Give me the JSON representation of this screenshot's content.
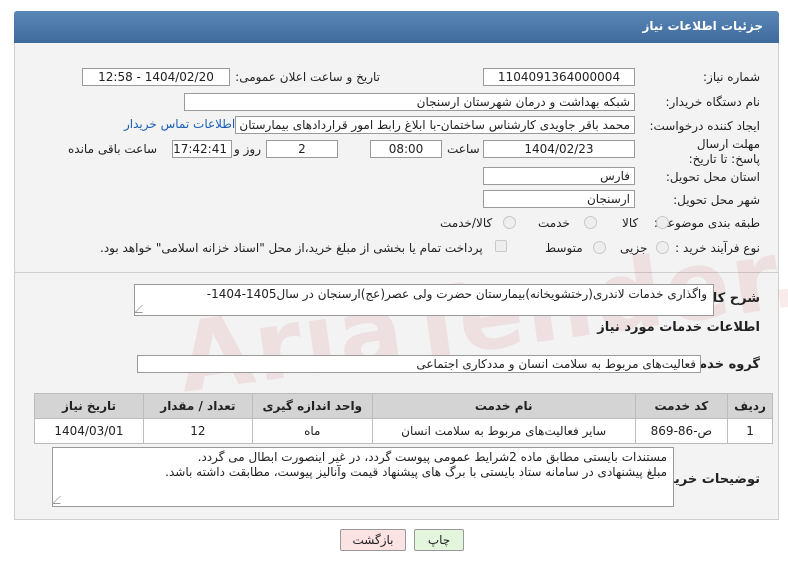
{
  "header": {
    "title": "جزئیات اطلاعات نیاز"
  },
  "fields": {
    "need_number_label": "شماره نیاز:",
    "need_number": "1104091364000004",
    "announce_label": "تاریخ و ساعت اعلان عمومی:",
    "announce_value": "1404/02/20 - 12:58",
    "buyer_org_label": "نام دستگاه خریدار:",
    "buyer_org": "شبکه بهداشت و درمان شهرستان ارسنجان",
    "creator_label": "ایجاد کننده درخواست:",
    "creator": "محمد باقر جاویدی کارشناس ساختمان-با ابلاغ رابط امور قراردادهای بیمارستان ش",
    "contact_link": "اطلاعات تماس خریدار",
    "deadline_label": "مهلت ارسال پاسخ: تا تاریخ:",
    "deadline_date": "1404/02/23",
    "time_label": "ساعت",
    "deadline_time": "08:00",
    "days_value": "2",
    "days_label": "روز و",
    "remaining_time": "17:42:41",
    "remaining_label": "ساعت باقی مانده",
    "province_label": "استان محل تحویل:",
    "province": "فارس",
    "city_label": "شهر محل تحویل:",
    "city": "ارسنجان",
    "category_label": "طبقه بندی موضوعی:",
    "cat_goods": "کالا",
    "cat_service": "خدمت",
    "cat_goods_service": "کالا/خدمت",
    "process_label": "نوع فرآیند خرید :",
    "proc_minor": "جزیی",
    "proc_medium": "متوسط",
    "payment_note": "پرداخت تمام یا بخشی از مبلغ خرید،از محل \"اسناد خزانه اسلامی\" خواهد بود."
  },
  "description": {
    "label": "شرح کلی نیاز:",
    "text": "واگذاری خدمات لاندری(رختشویخانه)بیمارستان حضرت ولی عصر(عج)ارسنجان در سال1405-1404-"
  },
  "services": {
    "section_title": "اطلاعات خدمات مورد نیاز",
    "group_label": "گروه خدمت:",
    "group_value": "فعالیت‌های مربوط به سلامت انسان و مددکاری اجتماعی",
    "columns": [
      "ردیف",
      "کد خدمت",
      "نام خدمت",
      "واحد اندازه گیری",
      "تعداد / مقدار",
      "تاریخ نیاز"
    ],
    "rows": [
      [
        "1",
        "ص-86-869",
        "سایر فعالیت‌های مربوط به سلامت انسان",
        "ماه",
        "12",
        "1404/03/01"
      ]
    ]
  },
  "buyer_notes": {
    "label": "توضیحات خریدار:",
    "line1": "مستندات بایستی مطابق ماده 2شرایط عمومی پیوست گردد، در غیر اینصورت ابطال می گردد.",
    "line2": "مبلغ پیشنهادی در سامانه ستاد بایستی با برگ های پیشنهاد قیمت وآنالیز پیوست، مطابقت داشته باشد."
  },
  "buttons": {
    "print": "چاپ",
    "back": "بازگشت"
  },
  "watermark": "AriaTender.neT",
  "colors": {
    "header": "#4a77a8",
    "link": "#1a5fb4",
    "print_btn": "#e3f5dc",
    "back_btn": "#fbe3e3"
  }
}
